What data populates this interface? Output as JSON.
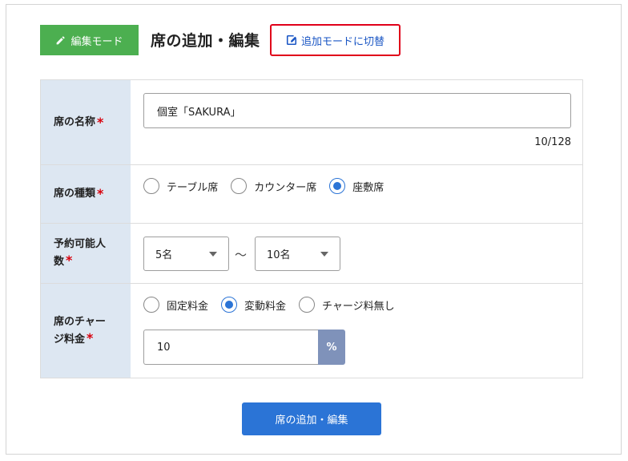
{
  "header": {
    "mode_badge": "編集モード",
    "title": "席の追加・編集",
    "switch_button": "追加モードに切替"
  },
  "form": {
    "name": {
      "label": "席の名称",
      "required_mark": "*",
      "value": "個室「SAKURA」",
      "counter": "10/128"
    },
    "type": {
      "label": "席の種類",
      "required_mark": "*",
      "options": [
        "テーブル席",
        "カウンター席",
        "座敷席"
      ],
      "selected": "座敷席"
    },
    "capacity": {
      "label_line1": "予約可能人",
      "label_line2": "数",
      "required_mark": "*",
      "min": "5名",
      "separator": "～",
      "max": "10名"
    },
    "charge": {
      "label_line1": "席のチャー",
      "label_line2": "ジ料金",
      "required_mark": "*",
      "options": [
        "固定料金",
        "変動料金",
        "チャージ料無し"
      ],
      "selected": "変動料金",
      "value": "10",
      "unit": "%"
    }
  },
  "submit_button": "席の追加・編集",
  "colors": {
    "badge_green": "#4caf50",
    "primary_blue": "#2b74d6",
    "highlight_red": "#e0001a",
    "label_bg": "#dde7f2",
    "unit_bg": "#7f92ba"
  }
}
